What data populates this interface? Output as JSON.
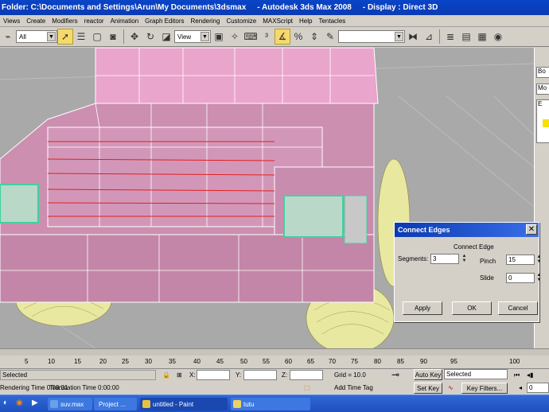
{
  "titlebar": {
    "folder": "Folder: C:\\Documents and Settings\\Arun\\My Documents\\3dsmax",
    "app": "- Autodesk 3ds Max 2008",
    "display": "- Display : Direct 3D"
  },
  "menu": [
    "Views",
    "Create",
    "Modifiers",
    "reactor",
    "Animation",
    "Graph Editors",
    "Rendering",
    "Customize",
    "MAXScript",
    "Help",
    "Tentacles"
  ],
  "toolbar": {
    "selection_filter": "All",
    "coord_system": "View",
    "icons": [
      "undo-icon",
      "redo-icon",
      "link-icon",
      "unlink-icon",
      "bind-icon",
      "filter-dropdown",
      "select-icon",
      "select-by-name-icon",
      "rect-region-icon",
      "window-crossing-icon",
      "move-icon",
      "rotate-icon",
      "scale-icon",
      "pivot-icon",
      "manipulate-icon",
      "keyboard-shortcut-icon",
      "snap-3d-icon",
      "angle-snap-icon",
      "percent-snap-icon",
      "spinner-snap-icon",
      "named-sets-icon",
      "mirror-icon",
      "align-icon",
      "layer-manager-icon",
      "curve-editor-icon"
    ]
  },
  "command_panel": {
    "slot1": "Bo",
    "slot2": "Mo",
    "slot3": "E"
  },
  "dialog": {
    "title": "Connect Edges",
    "group_label": "Connect Edge",
    "segments_label": "Segments:",
    "segments_value": "3",
    "pinch_label": "Pinch",
    "pinch_value": "15",
    "slide_label": "Slide",
    "slide_value": "0",
    "apply_label": "Apply",
    "ok_label": "OK",
    "cancel_label": "Cancel"
  },
  "timeline": {
    "ticks": [
      "5",
      "10",
      "15",
      "20",
      "25",
      "30",
      "35",
      "40",
      "45",
      "50",
      "55",
      "60",
      "65",
      "70",
      "75",
      "80",
      "85",
      "90",
      "95",
      "100"
    ]
  },
  "status": {
    "selection": "Selected",
    "x_label": "X:",
    "y_label": "Y:",
    "z_label": "Z:",
    "grid": "Grid = 10.0",
    "auto_key": "Auto Key",
    "selected_dropdown": "Selected",
    "rendering_time": "Rendering Time 0:00:01",
    "translation_time": "Translation Time 0:00:00",
    "add_time_tag": "Add Time Tag",
    "set_key": "Set Key",
    "key_filters": "Key Filters...",
    "frame": "0"
  },
  "taskbar": {
    "items": [
      "suv.max",
      "Project ...",
      "untitled - Paint",
      "tutu"
    ]
  },
  "colors": {
    "viewport_bg": "#a9a9a9",
    "mesh_fill": "#cc8fb0",
    "mesh_wire": "#ffffff",
    "selected_edges": "#e02020",
    "wheels": "#e8e8a0",
    "lights": "#40d0a0"
  }
}
